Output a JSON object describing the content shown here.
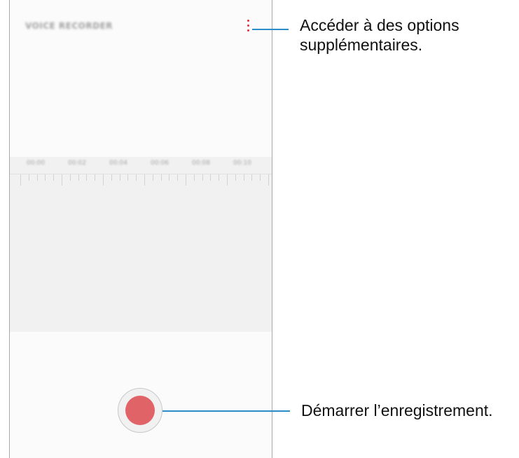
{
  "app": {
    "title": "VOICE RECORDER",
    "menu_icon": "more-vertical-icon",
    "timeline_labels": [
      "00:00",
      "00:02",
      "00:04",
      "00:06",
      "00:08",
      "00:10"
    ],
    "record_button_icon": "record-icon"
  },
  "callouts": {
    "options_line1": "Accéder à des options",
    "options_line2": "supplémentaires.",
    "record": "Démarrer l’enregistrement."
  },
  "colors": {
    "accent_line": "#2b8cc7",
    "menu_dots": "#e0303a",
    "record_button": "#e06467"
  }
}
